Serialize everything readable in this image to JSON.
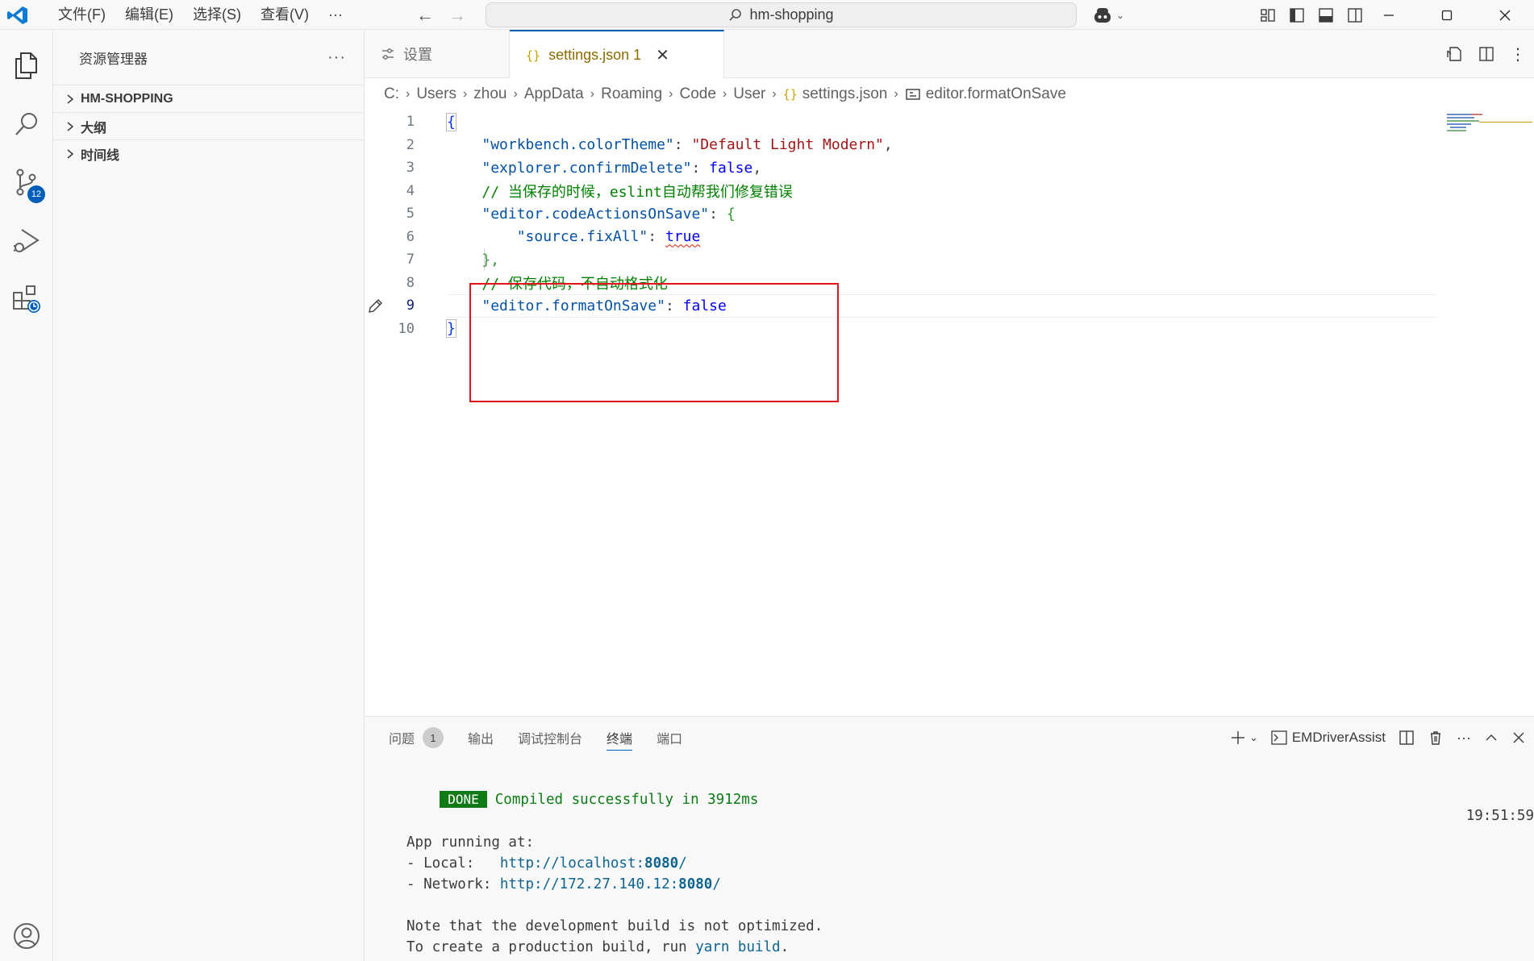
{
  "titlebar": {
    "menus": [
      "文件(F)",
      "编辑(E)",
      "选择(S)",
      "查看(V)",
      "···"
    ],
    "search_text": "hm-shopping"
  },
  "activitybar": {
    "items": [
      "explorer-icon",
      "search-icon",
      "source-control-icon",
      "run-debug-icon",
      "extensions-icon"
    ],
    "source_control_badge": "12"
  },
  "sidebar": {
    "title": "资源管理器",
    "more": "···",
    "sections": [
      "HM-SHOPPING",
      "大纲",
      "时间线"
    ]
  },
  "tabs": {
    "settings_label": "设置",
    "json_label": "settings.json 1",
    "close": "✕"
  },
  "breadcrumb": [
    "C:",
    "Users",
    "zhou",
    "AppData",
    "Roaming",
    "Code",
    "User",
    "settings.json",
    "editor.formatOnSave"
  ],
  "editor": {
    "line_numbers": [
      "1",
      "2",
      "3",
      "4",
      "5",
      "6",
      "7",
      "8",
      "9",
      "10"
    ],
    "active_line": "9",
    "lines": {
      "l1": "{",
      "l2_key": "\"workbench.colorTheme\"",
      "l2_colon": ": ",
      "l2_value": "\"Default Light Modern\"",
      "l2_end": ",",
      "l3_key": "\"explorer.confirmDelete\"",
      "l3_colon": ": ",
      "l3_value": "false",
      "l3_end": ",",
      "l4_comment": "// 当保存的时候，eslint自动帮我们修复错误",
      "l5_key": "\"editor.codeActionsOnSave\"",
      "l5_colon": ": ",
      "l5_value": "{",
      "l6_key": "\"source.fixAll\"",
      "l6_colon": ": ",
      "l6_value": "true",
      "l7": "},",
      "l8_comment": "// 保存代码，不自动格式化",
      "l9_key": "\"editor.formatOnSave\"",
      "l9_colon": ": ",
      "l9_value": "false",
      "l10": "}"
    }
  },
  "panel": {
    "tabs": [
      "问题",
      "输出",
      "调试控制台",
      "终端",
      "端口"
    ],
    "problems_count": "1",
    "active_tab": "终端",
    "terminal_name": "EMDriverAssist",
    "terminal": {
      "done": "DONE",
      "compiled": "Compiled successfully in 3912ms",
      "time": "19:51:59",
      "running": "App running at:",
      "local_label": "- Local:   ",
      "local_url_pre": "http://localhost:",
      "local_port": "8080",
      "local_url_post": "/",
      "network_label": "- Network: ",
      "network_url_pre": "http://172.27.140.12:",
      "network_port": "8080",
      "network_url_post": "/",
      "note": "Note that the development build is not optimized.",
      "prod_pre": "To create a production build, run ",
      "prod_cmd": "yarn build",
      "prod_post": "."
    }
  },
  "colors": {
    "accent": "#005fb8",
    "highlight_box": "#e5141c",
    "done_green": "#0f7a16"
  }
}
